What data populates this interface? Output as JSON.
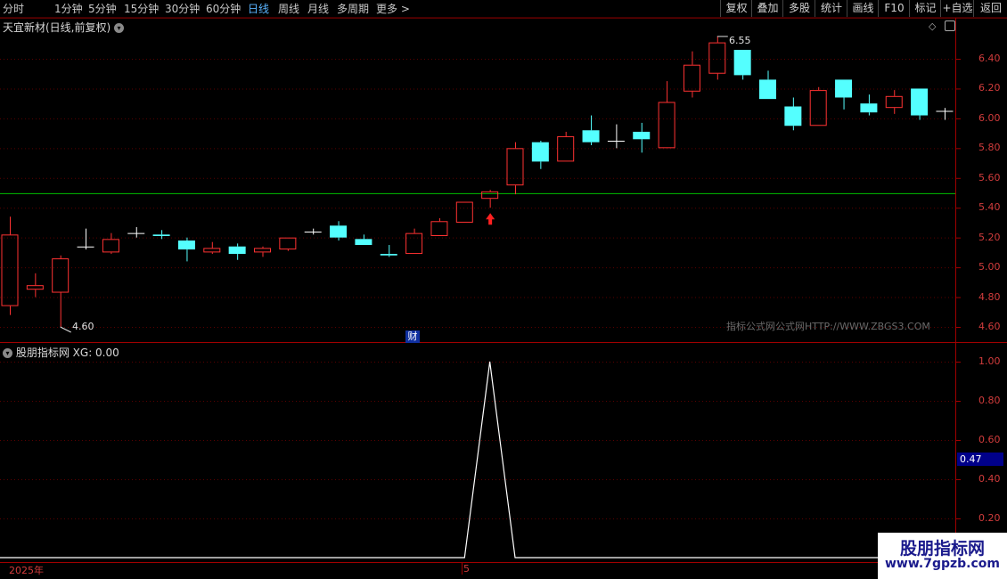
{
  "toolbar": {
    "periods": [
      "分时",
      "1分钟",
      "5分钟",
      "15分钟",
      "30分钟",
      "60分钟",
      "日线",
      "周线",
      "月线",
      "多周期",
      "更多 >"
    ],
    "active_period": "日线",
    "buttons": [
      "复权",
      "叠加",
      "多股",
      "统计",
      "画线",
      "F10",
      "标记",
      "+自选",
      "返回"
    ]
  },
  "main_chart": {
    "title": "天宜新材(日线,前复权)",
    "high_label": "6.55",
    "low_label": "4.60",
    "finance_marker": "财",
    "watermark": "指标公式网公式网HTTP://WWW.ZBGS3.COM",
    "y_axis_labels": [
      "6.40",
      "6.20",
      "6.00",
      "5.80",
      "5.60",
      "5.40",
      "5.20",
      "5.00",
      "4.80",
      "4.60"
    ],
    "colors": {
      "up": "#ff3232",
      "down": "#54ffff",
      "flat": "#ffffff",
      "level_line": "#00c000"
    }
  },
  "indicator": {
    "title": "股朋指标网",
    "series_label": "XG: 0.00",
    "y_axis_labels": [
      "1.00",
      "0.80",
      "0.60",
      "0.40",
      "0.20"
    ],
    "current_value": "0.47"
  },
  "time_axis": {
    "year_label": "2025年",
    "month_label": "5"
  },
  "logo": {
    "name": "股朋指标网",
    "url": "www.7gpzb.com"
  },
  "chart_data": {
    "type": "candlestick",
    "title": "天宜新材(日线,前复权)",
    "ylim": [
      4.54,
      6.66
    ],
    "support_line": 5.495,
    "candles": [
      {
        "o": 4.74,
        "h": 5.34,
        "l": 4.68,
        "c": 5.22
      },
      {
        "o": 4.85,
        "h": 4.96,
        "l": 4.8,
        "c": 4.88
      },
      {
        "o": 4.83,
        "h": 5.08,
        "l": 4.6,
        "c": 5.06
      },
      {
        "o": 5.14,
        "h": 5.26,
        "l": 5.12,
        "c": 5.14
      },
      {
        "o": 5.1,
        "h": 5.23,
        "l": 5.09,
        "c": 5.19
      },
      {
        "o": 5.23,
        "h": 5.27,
        "l": 5.2,
        "c": 5.23
      },
      {
        "o": 5.22,
        "h": 5.25,
        "l": 5.19,
        "c": 5.21
      },
      {
        "o": 5.18,
        "h": 5.2,
        "l": 5.04,
        "c": 5.12
      },
      {
        "o": 5.1,
        "h": 5.17,
        "l": 5.09,
        "c": 5.13
      },
      {
        "o": 5.14,
        "h": 5.16,
        "l": 5.05,
        "c": 5.09
      },
      {
        "o": 5.1,
        "h": 5.14,
        "l": 5.07,
        "c": 5.13
      },
      {
        "o": 5.12,
        "h": 5.2,
        "l": 5.11,
        "c": 5.2
      },
      {
        "o": 5.24,
        "h": 5.26,
        "l": 5.22,
        "c": 5.24
      },
      {
        "o": 5.28,
        "h": 5.31,
        "l": 5.18,
        "c": 5.2
      },
      {
        "o": 5.19,
        "h": 5.22,
        "l": 5.15,
        "c": 5.15
      },
      {
        "o": 5.09,
        "h": 5.15,
        "l": 5.07,
        "c": 5.08
      },
      {
        "o": 5.09,
        "h": 5.26,
        "l": 5.09,
        "c": 5.23
      },
      {
        "o": 5.21,
        "h": 5.33,
        "l": 5.21,
        "c": 5.31
      },
      {
        "o": 5.3,
        "h": 5.44,
        "l": 5.3,
        "c": 5.44
      },
      {
        "o": 5.46,
        "h": 5.52,
        "l": 5.4,
        "c": 5.51
      },
      {
        "o": 5.55,
        "h": 5.84,
        "l": 5.49,
        "c": 5.8
      },
      {
        "o": 5.84,
        "h": 5.85,
        "l": 5.66,
        "c": 5.71
      },
      {
        "o": 5.71,
        "h": 5.91,
        "l": 5.71,
        "c": 5.88
      },
      {
        "o": 5.92,
        "h": 6.02,
        "l": 5.82,
        "c": 5.84
      },
      {
        "o": 5.85,
        "h": 5.96,
        "l": 5.8,
        "c": 5.85
      },
      {
        "o": 5.91,
        "h": 5.97,
        "l": 5.77,
        "c": 5.86
      },
      {
        "o": 5.8,
        "h": 6.25,
        "l": 5.8,
        "c": 6.11
      },
      {
        "o": 6.18,
        "h": 6.45,
        "l": 6.14,
        "c": 6.36
      },
      {
        "o": 6.3,
        "h": 6.55,
        "l": 6.26,
        "c": 6.51
      },
      {
        "o": 6.46,
        "h": 6.46,
        "l": 6.26,
        "c": 6.29
      },
      {
        "o": 6.26,
        "h": 6.32,
        "l": 6.13,
        "c": 6.13
      },
      {
        "o": 6.08,
        "h": 6.14,
        "l": 5.92,
        "c": 5.95
      },
      {
        "o": 5.95,
        "h": 6.21,
        "l": 5.95,
        "c": 6.19
      },
      {
        "o": 6.26,
        "h": 6.26,
        "l": 6.06,
        "c": 6.14
      },
      {
        "o": 6.1,
        "h": 6.16,
        "l": 6.02,
        "c": 6.04
      },
      {
        "o": 6.07,
        "h": 6.19,
        "l": 6.03,
        "c": 6.15
      },
      {
        "o": 6.2,
        "h": 6.2,
        "l": 5.99,
        "c": 6.02
      },
      {
        "o": 6.05,
        "h": 6.07,
        "l": 5.99,
        "c": 6.05
      }
    ],
    "signal_index": 19,
    "indicator_series": {
      "name": "XG",
      "ylim": [
        0,
        1.1
      ],
      "values": [
        0,
        0,
        0,
        0,
        0,
        0,
        0,
        0,
        0,
        0,
        0,
        0,
        0,
        0,
        0,
        0,
        0,
        0,
        0,
        1,
        0,
        0,
        0,
        0,
        0,
        0,
        0,
        0,
        0,
        0,
        0,
        0,
        0,
        0,
        0,
        0,
        0,
        0
      ]
    }
  }
}
